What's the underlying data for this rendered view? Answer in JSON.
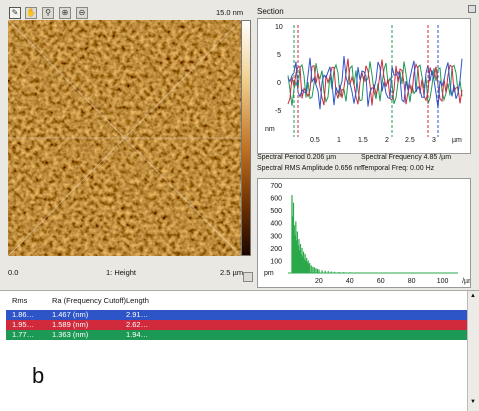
{
  "image_panel": {
    "scale_max": "15.0 nm",
    "label_left": "0.0",
    "label_center": "1: Height",
    "label_right": "2.5 µm"
  },
  "section": {
    "title": "Section",
    "y_unit": "nm",
    "y_ticks": [
      "10",
      "5",
      "0",
      "-5"
    ],
    "x_ticks": [
      "0.5",
      "1",
      "1.5",
      "2",
      "2.5",
      "3"
    ],
    "x_unit": "µm",
    "spectral_period": "Spectral Period 0.206 µm",
    "spectral_frequency": "Spectral Frequency 4.85 /µm",
    "rms_amplitude": "Spectral RMS Amplitude 0.656 nm",
    "temporal_freq": "Temporal Freq: 0.00 Hz"
  },
  "chart_data": {
    "type": "bar",
    "title": "",
    "xlabel": "/µm",
    "ylabel": "pm",
    "xlim": [
      0,
      110
    ],
    "ylim": [
      0,
      700
    ],
    "x_ticks": [
      "20",
      "40",
      "60",
      "80",
      "100"
    ],
    "y_ticks": [
      "700",
      "600",
      "500",
      "400",
      "300",
      "200",
      "100"
    ],
    "x": [
      2.5,
      3,
      3.5,
      4,
      4.5,
      5,
      5.5,
      6,
      6.5,
      7,
      7.5,
      8,
      8.5,
      9,
      9.5,
      10,
      10.5,
      11,
      11.5,
      12,
      12.5,
      13,
      13.5,
      14,
      15,
      16,
      17,
      18,
      19,
      20,
      22,
      24,
      26,
      28,
      30,
      33,
      36,
      40,
      45,
      50,
      60,
      70,
      80,
      90,
      100
    ],
    "values": [
      620,
      450,
      560,
      380,
      300,
      410,
      260,
      330,
      220,
      270,
      180,
      230,
      150,
      200,
      130,
      170,
      110,
      150,
      95,
      120,
      85,
      100,
      70,
      80,
      60,
      50,
      45,
      38,
      32,
      28,
      22,
      18,
      15,
      12,
      10,
      8,
      7,
      6,
      5,
      4,
      3,
      3,
      2,
      2,
      2
    ],
    "color": "#2aa84a"
  },
  "table": {
    "headers": [
      "Rms",
      "Ra (Frequency Cutoff)",
      "Length"
    ],
    "rows": [
      {
        "rms": "1.86…",
        "ra": "1.467 (nm)",
        "length": "2.91…",
        "color": "#2e55c8"
      },
      {
        "rms": "1.95…",
        "ra": "1.589 (nm)",
        "length": "2.62…",
        "color": "#d02a3c"
      },
      {
        "rms": "1.77…",
        "ra": "1.363 (nm)",
        "length": "1.94…",
        "color": "#1c9a55"
      }
    ]
  },
  "panel_label": "b"
}
